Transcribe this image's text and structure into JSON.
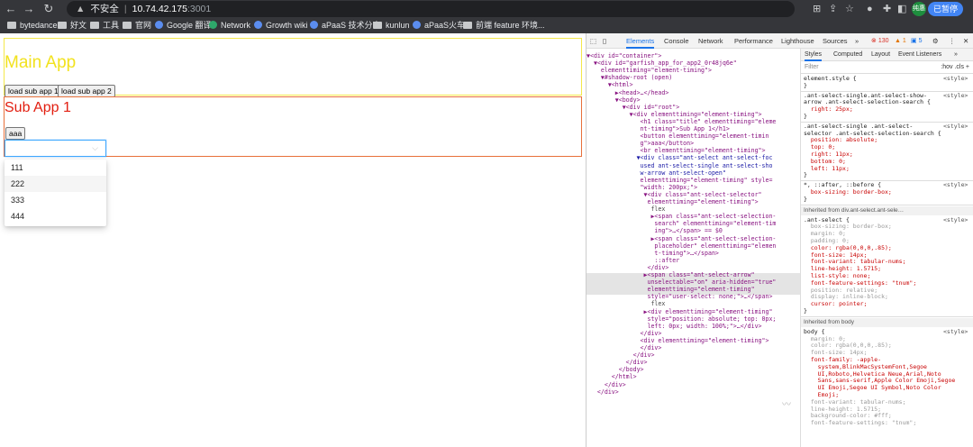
{
  "browser": {
    "address": {
      "security": "不安全",
      "host": "10.74.42.175",
      "port": ":3001"
    },
    "profile": {
      "initial": "纯惠",
      "status": "已暂停"
    },
    "bookmarks": [
      "bytedance",
      "好文",
      "工具",
      "官网",
      "Google 翻译",
      "Network",
      "Growth wiki",
      "aPaaS 技术分享",
      "kunlun",
      "aPaaS火车",
      "前端 feature 环境..."
    ]
  },
  "page": {
    "main_title": "Main App",
    "buttons": [
      "load sub app 1",
      "load sub app 2"
    ],
    "sub_title": "Sub App 1",
    "aaa_button": "aaa",
    "select_options": [
      "111",
      "222",
      "333",
      "444"
    ]
  },
  "devtools": {
    "tabs": [
      "Elements",
      "Console",
      "Network",
      "Performance",
      "Lighthouse",
      "Sources",
      "»"
    ],
    "errors": "130",
    "warnings": "1",
    "info": "5",
    "style_tabs": [
      "Styles",
      "Computed",
      "Layout",
      "Event Listeners",
      "»"
    ],
    "filter_placeholder": "Filter",
    "filter_tools": ":hov  .cls  +",
    "dom_lines": [
      "▼<div id=\"container\">",
      "  ▼<div id=\"garfish_app_for_app2_0r48jq6e\"",
      "    elementtiming=\"element-timing\">",
      "    ▼#shadow-root (open)",
      "      ▼<html>",
      "        ▶<head>…</head>",
      "        ▼<body>",
      "          ▼<div id=\"root\">",
      "            ▼<div elementtiming=\"element-timing\">",
      "               <h1 class=\"title\" elementtiming=\"eleme",
      "               nt-timing\">Sub App 1</h1>",
      "               <button elementtiming=\"element-timin",
      "               g\">aaa</button>",
      "               <br elementtiming=\"element-timing\">",
      "              ▼<div class=\"ant-select ant-select-foc",
      "               used ant-select-single ant-select-sho",
      "               w-arrow ant-select-open\"",
      "               elementtiming=\"element-timing\" style=",
      "               \"width: 200px;\">",
      "                ▼<div class=\"ant-select-selector\"",
      "                 elementtiming=\"element-timing\">",
      "                  flex",
      "                  ▶<span class=\"ant-select-selection-",
      "                   search\" elementtiming=\"element-tim",
      "                   ing\">…</span> == $0",
      "                  ▶<span class=\"ant-select-selection-",
      "                   placeholder\" elementtiming=\"elemen",
      "                   t-timing\">…</span>",
      "                   ::after",
      "                 </div>",
      "                ▶<span class=\"ant-select-arrow\"",
      "                 unselectable=\"on\" aria-hidden=\"true\"",
      "                 elementtiming=\"element-timing\"",
      "                 style=\"user-select: none;\">…</span>",
      "                  flex",
      "                ▶<div elementtiming=\"element-timing\"",
      "                 style=\"position: absolute; top: 0px;",
      "                 left: 0px; width: 100%;\">…</div>",
      "               </div>",
      "               <div elementtiming=\"element-timing\">",
      "               </div>",
      "             </div>",
      "           </div>",
      "         </body>",
      "       </html>",
      "     </div>",
      "   </div>"
    ],
    "css_lines": [
      "element.style {",
      "}",
      ".ant-select-single.ant-select-show-",
      "arrow .ant-select-selection-search {",
      "  right: 25px;",
      "}",
      ".ant-select-single .ant-select-",
      "selector .ant-select-selection-search {",
      "  position: absolute;",
      "  top: 0;",
      "  right: 11px;",
      "  bottom: 0;",
      "  left: 11px;",
      "}",
      "*, ::after, ::before {",
      "  box-sizing: border-box;",
      "}",
      ".ant-select {",
      "  box-sizing: border-box;",
      "  margin: 0;",
      "  padding: 0;",
      "  color: rgba(0,0,0,.85);",
      "  font-size: 14px;",
      "  font-variant: tabular-nums;",
      "  line-height: 1.5715;",
      "  list-style: none;",
      "  font-feature-settings: \"tnum\";",
      "  position: relative;",
      "  display: inline-block;",
      "  cursor: pointer;",
      "}",
      "body {",
      "  margin: 0;",
      "  color: rgba(0,0,0,.85);",
      "  font-size: 14px;",
      "  font-family: -apple-",
      "    system,BlinkMacSystemFont,Segoe",
      "    UI,Roboto,Helvetica Neue,Arial,Noto",
      "    Sans,sans-serif,Apple Color Emoji,Segoe",
      "    UI Emoji,Segoe UI Symbol,Noto Color",
      "    Emoji;",
      "  font-variant: tabular-nums;",
      "  line-height: 1.5715;",
      "  background-color: #fff;",
      "  font-feature-settings: \"tnum\";"
    ],
    "source_label": "<style>",
    "inherited_1": "Inherited from div.ant-select.ant-sele…",
    "inherited_2": "Inherited from body"
  }
}
